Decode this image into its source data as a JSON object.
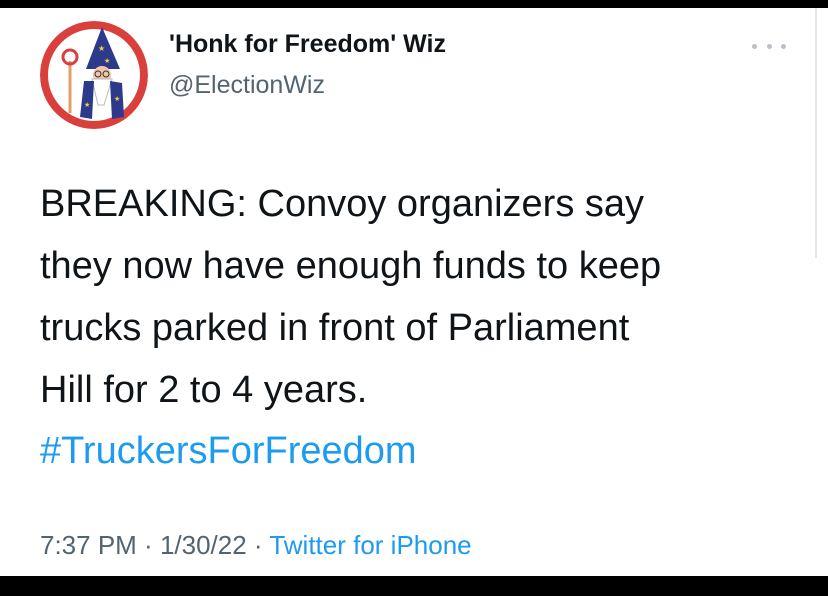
{
  "tweet": {
    "display_name": "'Honk for Freedom' Wiz",
    "handle": "@ElectionWiz",
    "body_lines": [
      "BREAKING: Convoy organizers say",
      "they now have enough funds to keep",
      "trucks parked in front of Parliament",
      "Hill for 2 to 4 years."
    ],
    "hashtag": "#TruckersForFreedom",
    "time": "7:37 PM",
    "date": "1/30/22",
    "separator": " · ",
    "source": "Twitter for iPhone"
  },
  "icons": {
    "avatar": "wizard-avatar-icon",
    "more": "more-options-icon"
  },
  "colors": {
    "text": "#0f1419",
    "secondary": "#536471",
    "link": "#1d9bf0",
    "avatar_bg": "#d9403c",
    "background": "#ffffff"
  }
}
